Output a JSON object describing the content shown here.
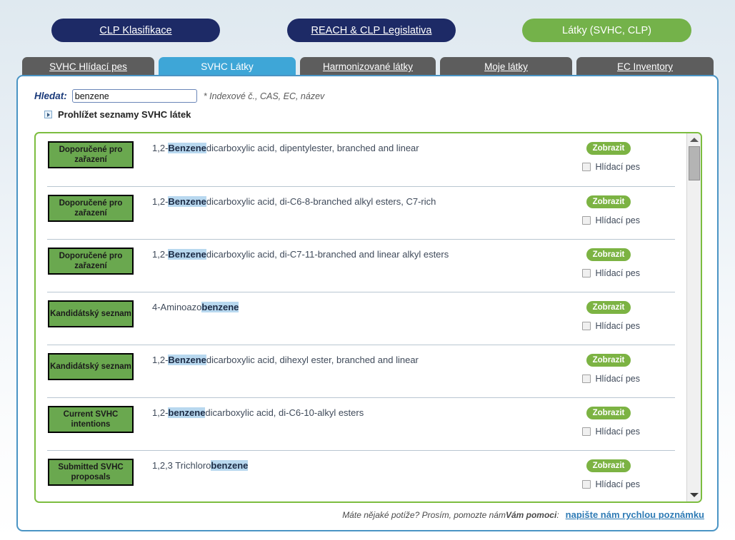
{
  "topnav": {
    "buttons": [
      {
        "label": "CLP Klasifikace",
        "style": "dark"
      },
      {
        "label": "REACH & CLP Legislativa",
        "style": "dark"
      },
      {
        "label": "Látky (SVHC, CLP)",
        "style": "green"
      }
    ],
    "colors": {
      "dark": "#1d2a66",
      "green": "#74b24a"
    }
  },
  "tabs": [
    {
      "label": "SVHC Hlídací pes",
      "active": false
    },
    {
      "label": "SVHC Látky",
      "active": true
    },
    {
      "label": "Harmonizované látky",
      "active": false
    },
    {
      "label": "Moje látky",
      "active": false
    },
    {
      "label": "EC Inventory",
      "active": false
    }
  ],
  "tab_colors": {
    "active": "#3ea6d7",
    "inactive": "#5d5d5d"
  },
  "search": {
    "label": "Hledat:",
    "value": "benzene",
    "placeholder": "",
    "hint": "* Indexové č., CAS, EC, název"
  },
  "browse": {
    "label": "Prohlížet seznamy SVHC látek",
    "icon": "triangle-right-icon"
  },
  "results": {
    "button_label": "Zobrazit",
    "watch_label": "Hlídací pes",
    "badge_color": "#6aa84f",
    "highlight_color": "#b8d8ef",
    "border_color": "#7cbd3f",
    "rows": [
      {
        "badge": "Doporučené pro zařazení",
        "prefix": "1,2-",
        "highlight": "Benzene",
        "highlight_bold": true,
        "suffix": "dicarboxylic acid, dipentylester, branched and linear",
        "checked": false
      },
      {
        "badge": "Doporučené pro zařazení",
        "prefix": "1,2-",
        "highlight": "Benzene",
        "highlight_bold": true,
        "suffix": "dicarboxylic acid, di-C6-8-branched alkyl esters, C7-rich",
        "checked": false
      },
      {
        "badge": "Doporučené pro zařazení",
        "prefix": "1,2-",
        "highlight": "Benzene",
        "highlight_bold": true,
        "suffix": "dicarboxylic acid, di-C7-11-branched and linear alkyl esters",
        "checked": false
      },
      {
        "badge": "Kandidátský seznam",
        "prefix": "4-Aminoazo",
        "highlight": "benzene",
        "highlight_bold": true,
        "suffix": "",
        "checked": false
      },
      {
        "badge": "Kandidátský seznam",
        "prefix": "1,2-",
        "highlight": "Benzene",
        "highlight_bold": true,
        "suffix": "dicarboxylic acid, dihexyl ester, branched and linear",
        "checked": false
      },
      {
        "badge": "Current SVHC intentions",
        "prefix": "1,2-",
        "highlight": "benzene",
        "highlight_bold": true,
        "suffix": "dicarboxylic acid, di-C6-10-alkyl esters",
        "checked": false
      },
      {
        "badge": "Submitted SVHC proposals",
        "prefix": "1,2,3 Trichloro",
        "highlight": "benzene",
        "highlight_bold": true,
        "suffix": "",
        "checked": false
      }
    ]
  },
  "footer": {
    "text_1": "Máte nějaké potíže? Prosím, pomozte nám ",
    "text_strong": "Vám pomoci",
    "text_2": ":",
    "link": "napište nám rychlou poznámku"
  }
}
